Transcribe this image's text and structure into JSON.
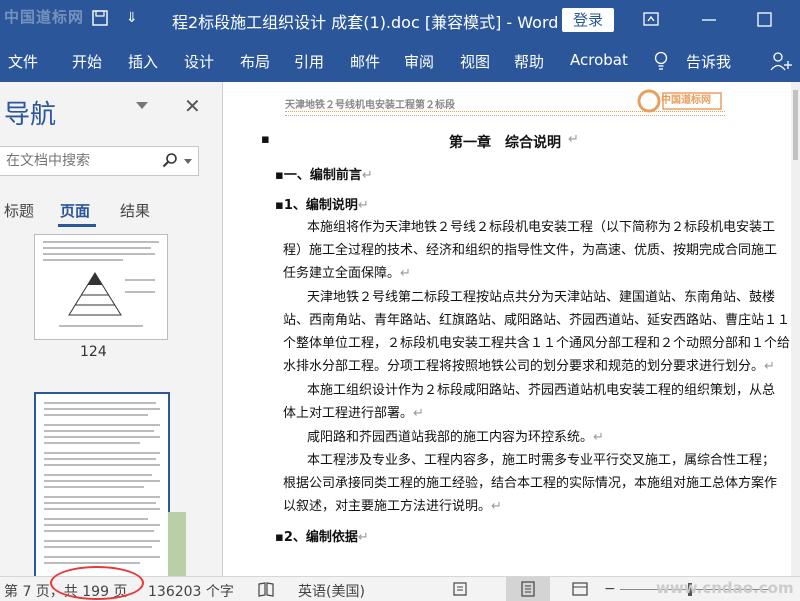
{
  "titlebar": {
    "watermark": "中国道标网",
    "qa_arrow": "⇓",
    "title": "程2标段施工组织设计 成套(1).doc [兼容模式] - Word",
    "login_label": "登录"
  },
  "ribbon": {
    "tabs": [
      "文件",
      "开始",
      "插入",
      "设计",
      "布局",
      "引用",
      "邮件",
      "审阅",
      "视图",
      "帮助",
      "Acrobat",
      "告诉我"
    ]
  },
  "nav": {
    "title": "导航",
    "search_placeholder": "在文档中搜索",
    "tabs": [
      "标题",
      "页面",
      "结果"
    ],
    "thumb_page_number": "124"
  },
  "document": {
    "header_text": "天津地铁２号线机电安装工程第２标段",
    "logo_text": "中国道标网",
    "para_mark": "↵",
    "chapter_title": "第一章　综合说明",
    "section_1": "一、编制前言",
    "subsection_1": "1、编制说明",
    "lines": [
      "本施组将作为天津地铁２号线２标段机电安装工程（以下简称为２标段机电安装工",
      "程）施工全过程的技术、经济和组织的指导性文件，为高速、优质、按期完成合同施工",
      "任务建立全面保障。",
      "天津地铁２号线第二标段工程按站点共分为天津站站、建国道站、东南角站、鼓楼",
      "站、西南角站、青年路站、红旗路站、咸阳路站、芥园西道站、延安西路站、曹庄站１１",
      "个整体单位工程，２标段机电安装工程共含１１个通风分部工程和２个动照分部和１个给",
      "水排水分部工程。分项工程将按照地铁公司的划分要求和规范的划分要求进行划分。",
      "本施工组织设计作为２标段咸阳路站、芥园西道站机电安装工程的组织策划，从总",
      "体上对工程进行部署。",
      "咸阳路和芥园西道站我部的施工内容为环控系统。",
      "本工程涉及专业多、工程内容多，施工时需多专业平行交叉施工，属综合性工程；",
      "根据公司承接同类工程的施工经验，结合本工程的实际情况，本施组对施工总体方案作",
      "以叙述，对主要施工方法进行说明。"
    ],
    "subsection_2": "2、编制依据"
  },
  "status": {
    "page_info": "第 7 页，共 199 页",
    "word_count": "136203 个字",
    "language": "英语(美国)",
    "watermark": "www.cndao.com",
    "zoom_minus": "−"
  }
}
